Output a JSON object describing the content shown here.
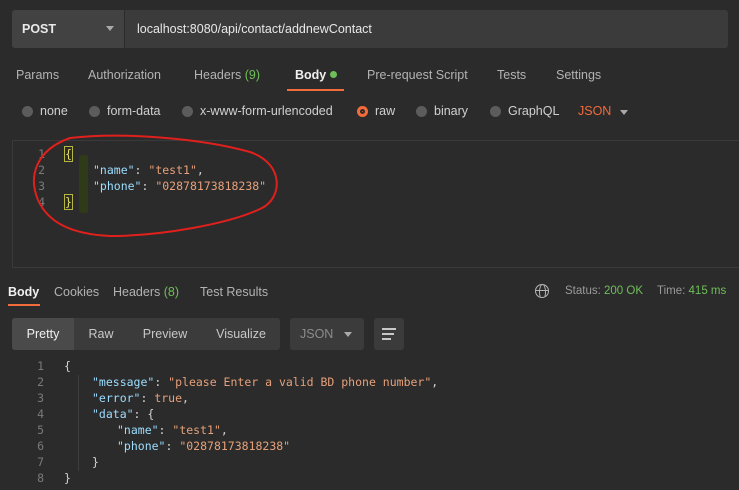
{
  "request": {
    "method": "POST",
    "url": "localhost:8080/api/contact/addnewContact"
  },
  "request_tabs": {
    "params": "Params",
    "authorization": "Authorization",
    "headers": "Headers",
    "headers_count": "(9)",
    "body": "Body",
    "prerequest": "Pre-request Script",
    "tests": "Tests",
    "settings": "Settings"
  },
  "body_modes": {
    "none": "none",
    "form_data": "form-data",
    "urlencoded": "x-www-form-urlencoded",
    "raw": "raw",
    "binary": "binary",
    "graphql": "GraphQL",
    "selected": "raw",
    "language": "JSON"
  },
  "request_body": {
    "line_numbers": [
      "1",
      "2",
      "3",
      "4"
    ],
    "open_brace": "{",
    "close_brace": "}",
    "name_key": "\"name\"",
    "name_value": "\"test1\"",
    "phone_key": "\"phone\"",
    "phone_value": "\"02878173818238\""
  },
  "response_tabs": {
    "body": "Body",
    "cookies": "Cookies",
    "headers": "Headers",
    "headers_count": "(8)",
    "test_results": "Test Results"
  },
  "response_meta": {
    "status_label": "Status:",
    "status_value": "200 OK",
    "time_label": "Time:",
    "time_value": "415 ms"
  },
  "response_view": {
    "pretty": "Pretty",
    "raw": "Raw",
    "preview": "Preview",
    "visualize": "Visualize",
    "format": "JSON"
  },
  "response_body": {
    "line_numbers": [
      "1",
      "2",
      "3",
      "4",
      "5",
      "6",
      "7",
      "8"
    ],
    "open_brace": "{",
    "close_brace": "}",
    "message_key": "\"message\"",
    "message_value": "\"please Enter a valid BD phone number\"",
    "error_key": "\"error\"",
    "error_value": "true",
    "data_key": "\"data\"",
    "name_key": "\"name\"",
    "name_value": "\"test1\"",
    "phone_key": "\"phone\"",
    "phone_value": "\"02878173818238\""
  },
  "colors": {
    "accent": "#f26b3a",
    "success": "#6fbf59",
    "annotation": "#e0201c"
  }
}
